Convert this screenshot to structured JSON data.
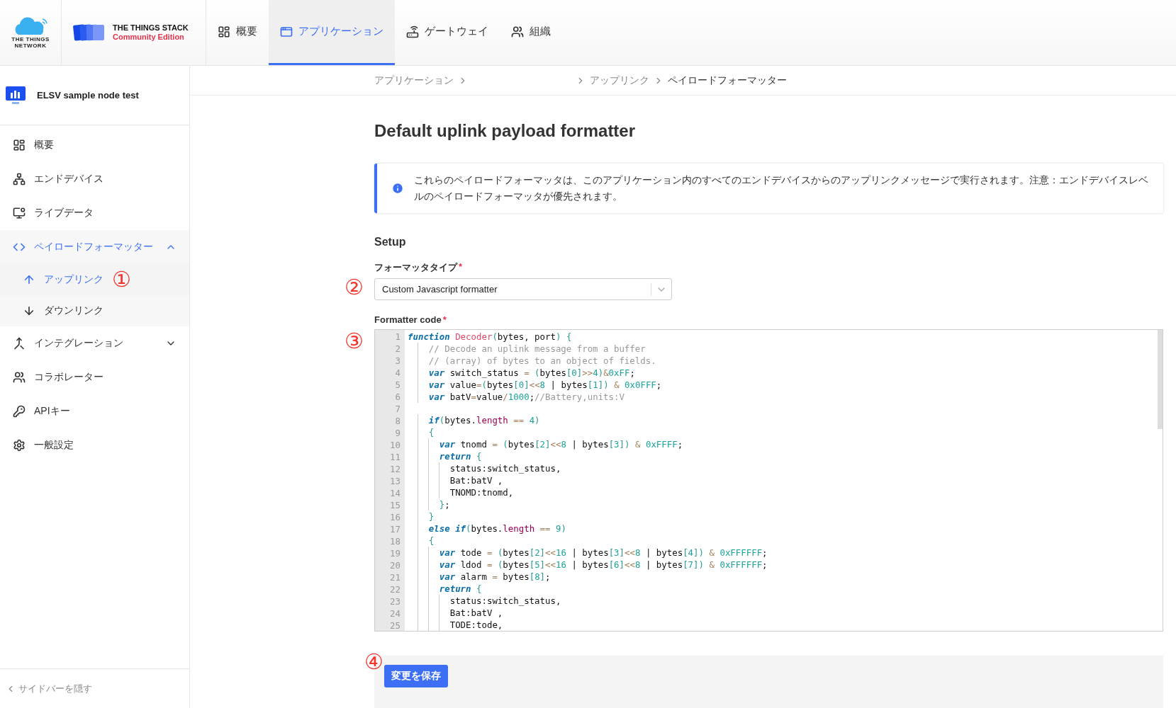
{
  "header": {
    "network_logo": {
      "line1": "THE THINGS",
      "line2": "NETWORK"
    },
    "stack_logo": {
      "title": "THE THINGS STACK",
      "edition": "Community Edition"
    },
    "nav": [
      {
        "label": "概要",
        "selected": false
      },
      {
        "label": "アプリケーション",
        "selected": true
      },
      {
        "label": "ゲートウェイ",
        "selected": false
      },
      {
        "label": "組織",
        "selected": false
      }
    ]
  },
  "sidebar": {
    "app_name": "ELSV sample node test",
    "items": [
      {
        "label": "概要",
        "selected": false
      },
      {
        "label": "エンドデバイス",
        "selected": false
      },
      {
        "label": "ライブデータ",
        "selected": false
      },
      {
        "label": "ペイロードフォーマッター",
        "selected": true,
        "expanded": true,
        "children": [
          {
            "label": "アップリンク",
            "selected": true,
            "marker": "①"
          },
          {
            "label": "ダウンリンク",
            "selected": false
          }
        ]
      },
      {
        "label": "インテグレーション",
        "selected": false,
        "expanded": false
      },
      {
        "label": "コラボレーター",
        "selected": false
      },
      {
        "label": "APIキー",
        "selected": false
      },
      {
        "label": "一般設定",
        "selected": false
      }
    ],
    "hide_sidebar": "サイドバーを隠す"
  },
  "main": {
    "breadcrumb": [
      {
        "label": "アプリケーション"
      },
      {
        "label": "アップリンク"
      },
      {
        "label": "ペイロードフォーマッター"
      }
    ],
    "title": "Default uplink payload formatter",
    "info": "これらのペイロードフォーマッタは、このアプリケーション内のすべてのエンドデバイスからのアップリンクメッセージで実行されます。注意：エンドデバイスレベルのペイロードフォーマッタが優先されます。",
    "section": "Setup",
    "formatter_type": {
      "label": "フォーマッタタイプ",
      "required_mark": "*",
      "value": "Custom Javascript formatter",
      "marker": "②"
    },
    "code": {
      "label": "Formatter code",
      "required_mark": "*",
      "marker": "③",
      "lines": [
        {
          "number": "1",
          "text": "function Decoder(bytes, port) {"
        },
        {
          "number": "2",
          "text": "    // Decode an uplink message from a buffer"
        },
        {
          "number": "3",
          "text": "    // (array) of bytes to an object of fields."
        },
        {
          "number": "4",
          "text": "    var switch_status = (bytes[0]>>4)&0xFF;"
        },
        {
          "number": "5",
          "text": "    var value=(bytes[0]<<8 | bytes[1]) & 0x0FFF;"
        },
        {
          "number": "6",
          "text": "    var batV=value/1000;//Battery,units:V"
        },
        {
          "number": "7"
        },
        {
          "number": "8",
          "text": "    if(bytes.length == 4)"
        },
        {
          "number": "9",
          "text": "    {"
        },
        {
          "number": "10",
          "text": "      var tnomd = (bytes[2]<<8 | bytes[3]) & 0xFFFF;"
        },
        {
          "number": "11",
          "text": "      return {"
        },
        {
          "number": "12",
          "text": "        status:switch_status,"
        },
        {
          "number": "13",
          "text": "        Bat:batV ,"
        },
        {
          "number": "14",
          "text": "        TNOMD:tnomd,"
        },
        {
          "number": "15",
          "text": "      };"
        },
        {
          "number": "16",
          "text": "    }"
        },
        {
          "number": "17",
          "text": "    else if(bytes.length == 9)"
        },
        {
          "number": "18",
          "text": "    {"
        },
        {
          "number": "19",
          "text": "      var tode = (bytes[2]<<16 | bytes[3]<<8 | bytes[4]) & 0xFFFFFF;"
        },
        {
          "number": "20",
          "text": "      var ldod = (bytes[5]<<16 | bytes[6]<<8 | bytes[7]) & 0xFFFFFF;"
        },
        {
          "number": "21",
          "text": "      var alarm = bytes[8];"
        },
        {
          "number": "22",
          "text": "      return {"
        },
        {
          "number": "23",
          "text": "        status:switch_status,"
        },
        {
          "number": "24",
          "text": "        Bat:batV ,"
        },
        {
          "number": "25",
          "text": "        TODE:tode,"
        }
      ]
    },
    "save_button": {
      "label": "変更を保存",
      "marker": "④"
    }
  }
}
